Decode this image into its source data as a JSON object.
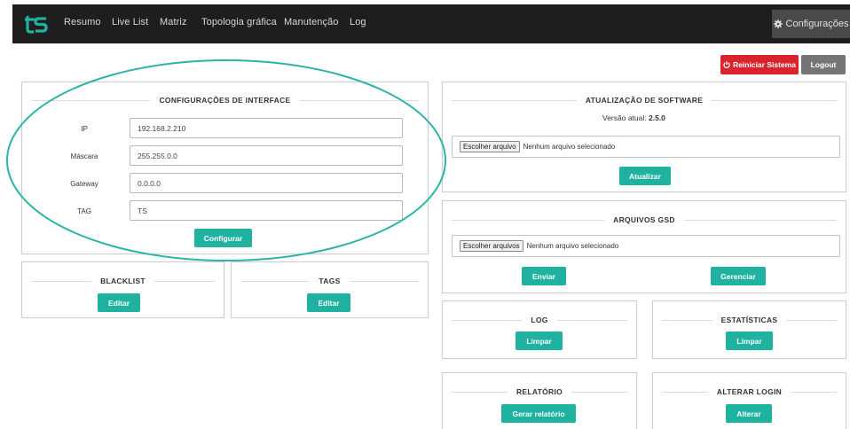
{
  "nav": {
    "logo_text": "ts",
    "items": [
      "Resumo",
      "Live List",
      "Matriz",
      "Topologia gráfica",
      "Manutenção",
      "Log"
    ],
    "config_label": "Configurações"
  },
  "actions": {
    "restart_label": "Reiniciar Sistema",
    "logout_label": "Logout"
  },
  "interface_panel": {
    "title": "CONFIGURAÇÕES DE INTERFACE",
    "fields": [
      {
        "label": "IP",
        "value": "192.168.2.210"
      },
      {
        "label": "Máscara",
        "value": "255.255.0.0"
      },
      {
        "label": "Gateway",
        "value": "0.0.0.0"
      },
      {
        "label": "TAG",
        "value": "TS"
      }
    ],
    "button": "Configurar"
  },
  "blacklist_panel": {
    "title": "BLACKLIST",
    "button": "Editar"
  },
  "tags_panel": {
    "title": "TAGS",
    "button": "Editar"
  },
  "software_panel": {
    "title": "ATUALIZAÇÃO DE SOFTWARE",
    "version_label": "Versão atual:",
    "version_value": "2.5.0",
    "file_button": "Escolher arquivo",
    "file_status": "Nenhum arquivo selecionado",
    "button": "Atualizar"
  },
  "gsd_panel": {
    "title": "ARQUIVOS GSD",
    "file_button": "Escolher arquivos",
    "file_status": "Nenhum arquivo selecionado",
    "send_button": "Enviar",
    "manage_button": "Gerenciar"
  },
  "log_panel": {
    "title": "LOG",
    "button": "Limpar"
  },
  "stats_panel": {
    "title": "ESTATÍSTICAS",
    "button": "Limpar"
  },
  "report_panel": {
    "title": "RELATÓRIO",
    "button": "Gerar relatório"
  },
  "login_panel": {
    "title": "ALTERAR LOGIN",
    "button": "Alterar"
  },
  "colors": {
    "navbar": "#1e1e1e",
    "accent_teal": "#1fb2a0",
    "danger": "#d9232d",
    "annotation": "#2bb3a8"
  }
}
